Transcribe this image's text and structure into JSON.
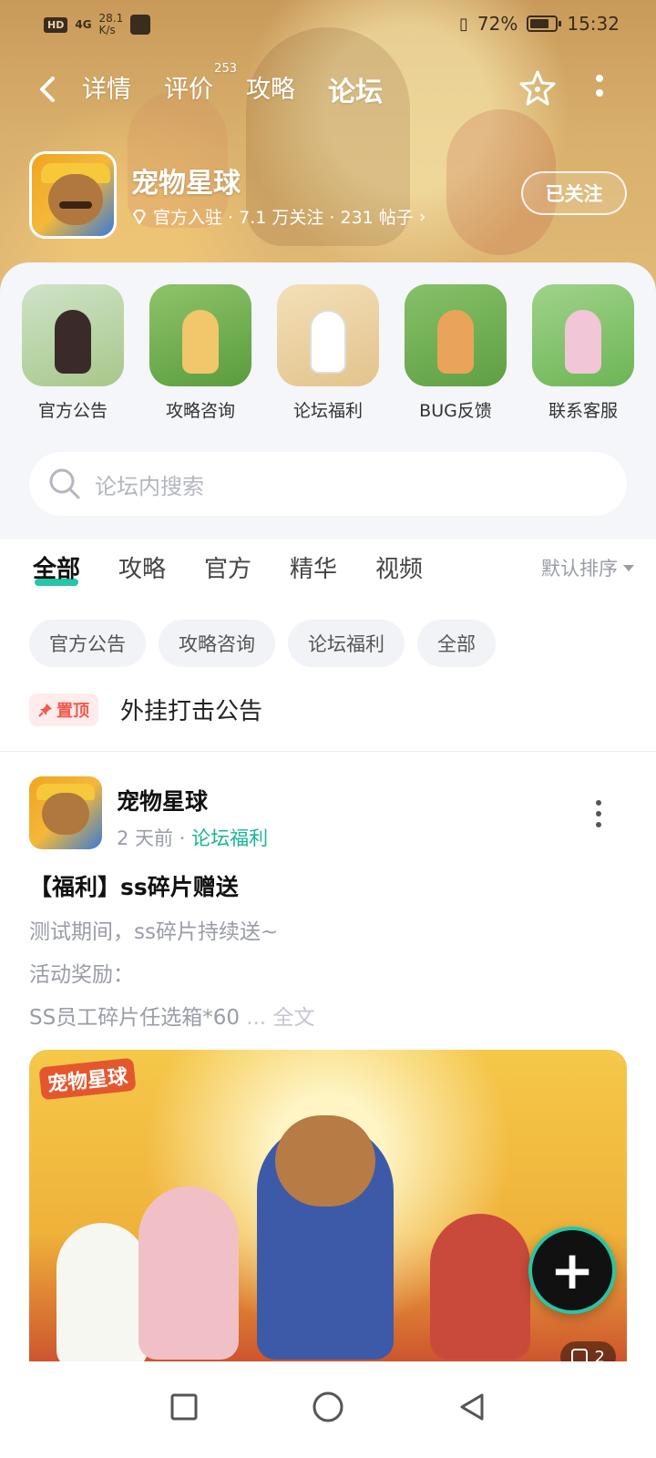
{
  "status_bar": {
    "network_badge": "HD",
    "signal": "4G",
    "speed_value": "28.1",
    "speed_unit": "K/s",
    "battery": "72%",
    "time": "15:32"
  },
  "nav": {
    "tabs": [
      {
        "label": "详情"
      },
      {
        "label": "评价",
        "badge": "253"
      },
      {
        "label": "攻略"
      },
      {
        "label": "论坛"
      }
    ],
    "active_tab": "论坛"
  },
  "forum": {
    "name": "宠物星球",
    "meta": "官方入驻 · 7.1 万关注 · 231 帖子",
    "follow_label": "已关注"
  },
  "quick_entries": [
    {
      "label": "官方公告"
    },
    {
      "label": "攻略咨询"
    },
    {
      "label": "论坛福利"
    },
    {
      "label": "BUG反馈"
    },
    {
      "label": "联系客服"
    }
  ],
  "search": {
    "placeholder": "论坛内搜索"
  },
  "filter": {
    "tabs": [
      {
        "label": "全部"
      },
      {
        "label": "攻略"
      },
      {
        "label": "官方"
      },
      {
        "label": "精华"
      },
      {
        "label": "视频"
      }
    ],
    "active_tab": "全部",
    "sort_label": "默认排序",
    "chips": [
      {
        "label": "官方公告"
      },
      {
        "label": "攻略咨询"
      },
      {
        "label": "论坛福利"
      },
      {
        "label": "全部"
      }
    ]
  },
  "pinned": {
    "badge": "置顶",
    "title": "外挂打击公告"
  },
  "post": {
    "author": "宠物星球",
    "time": "2 天前",
    "category": "论坛福利",
    "title": "【福利】ss碎片赠送",
    "body_lines": [
      "测试期间，ss碎片持续送~",
      "活动奖励：",
      "SS员工碎片任选箱*60"
    ],
    "ellipsis": "...",
    "full_text_label": "全文",
    "image_logo": "宠物星球",
    "image_count": "2"
  },
  "colors": {
    "accent": "#26c6a6",
    "category_text": "#19b396",
    "pin_red": "#f05a4f"
  }
}
